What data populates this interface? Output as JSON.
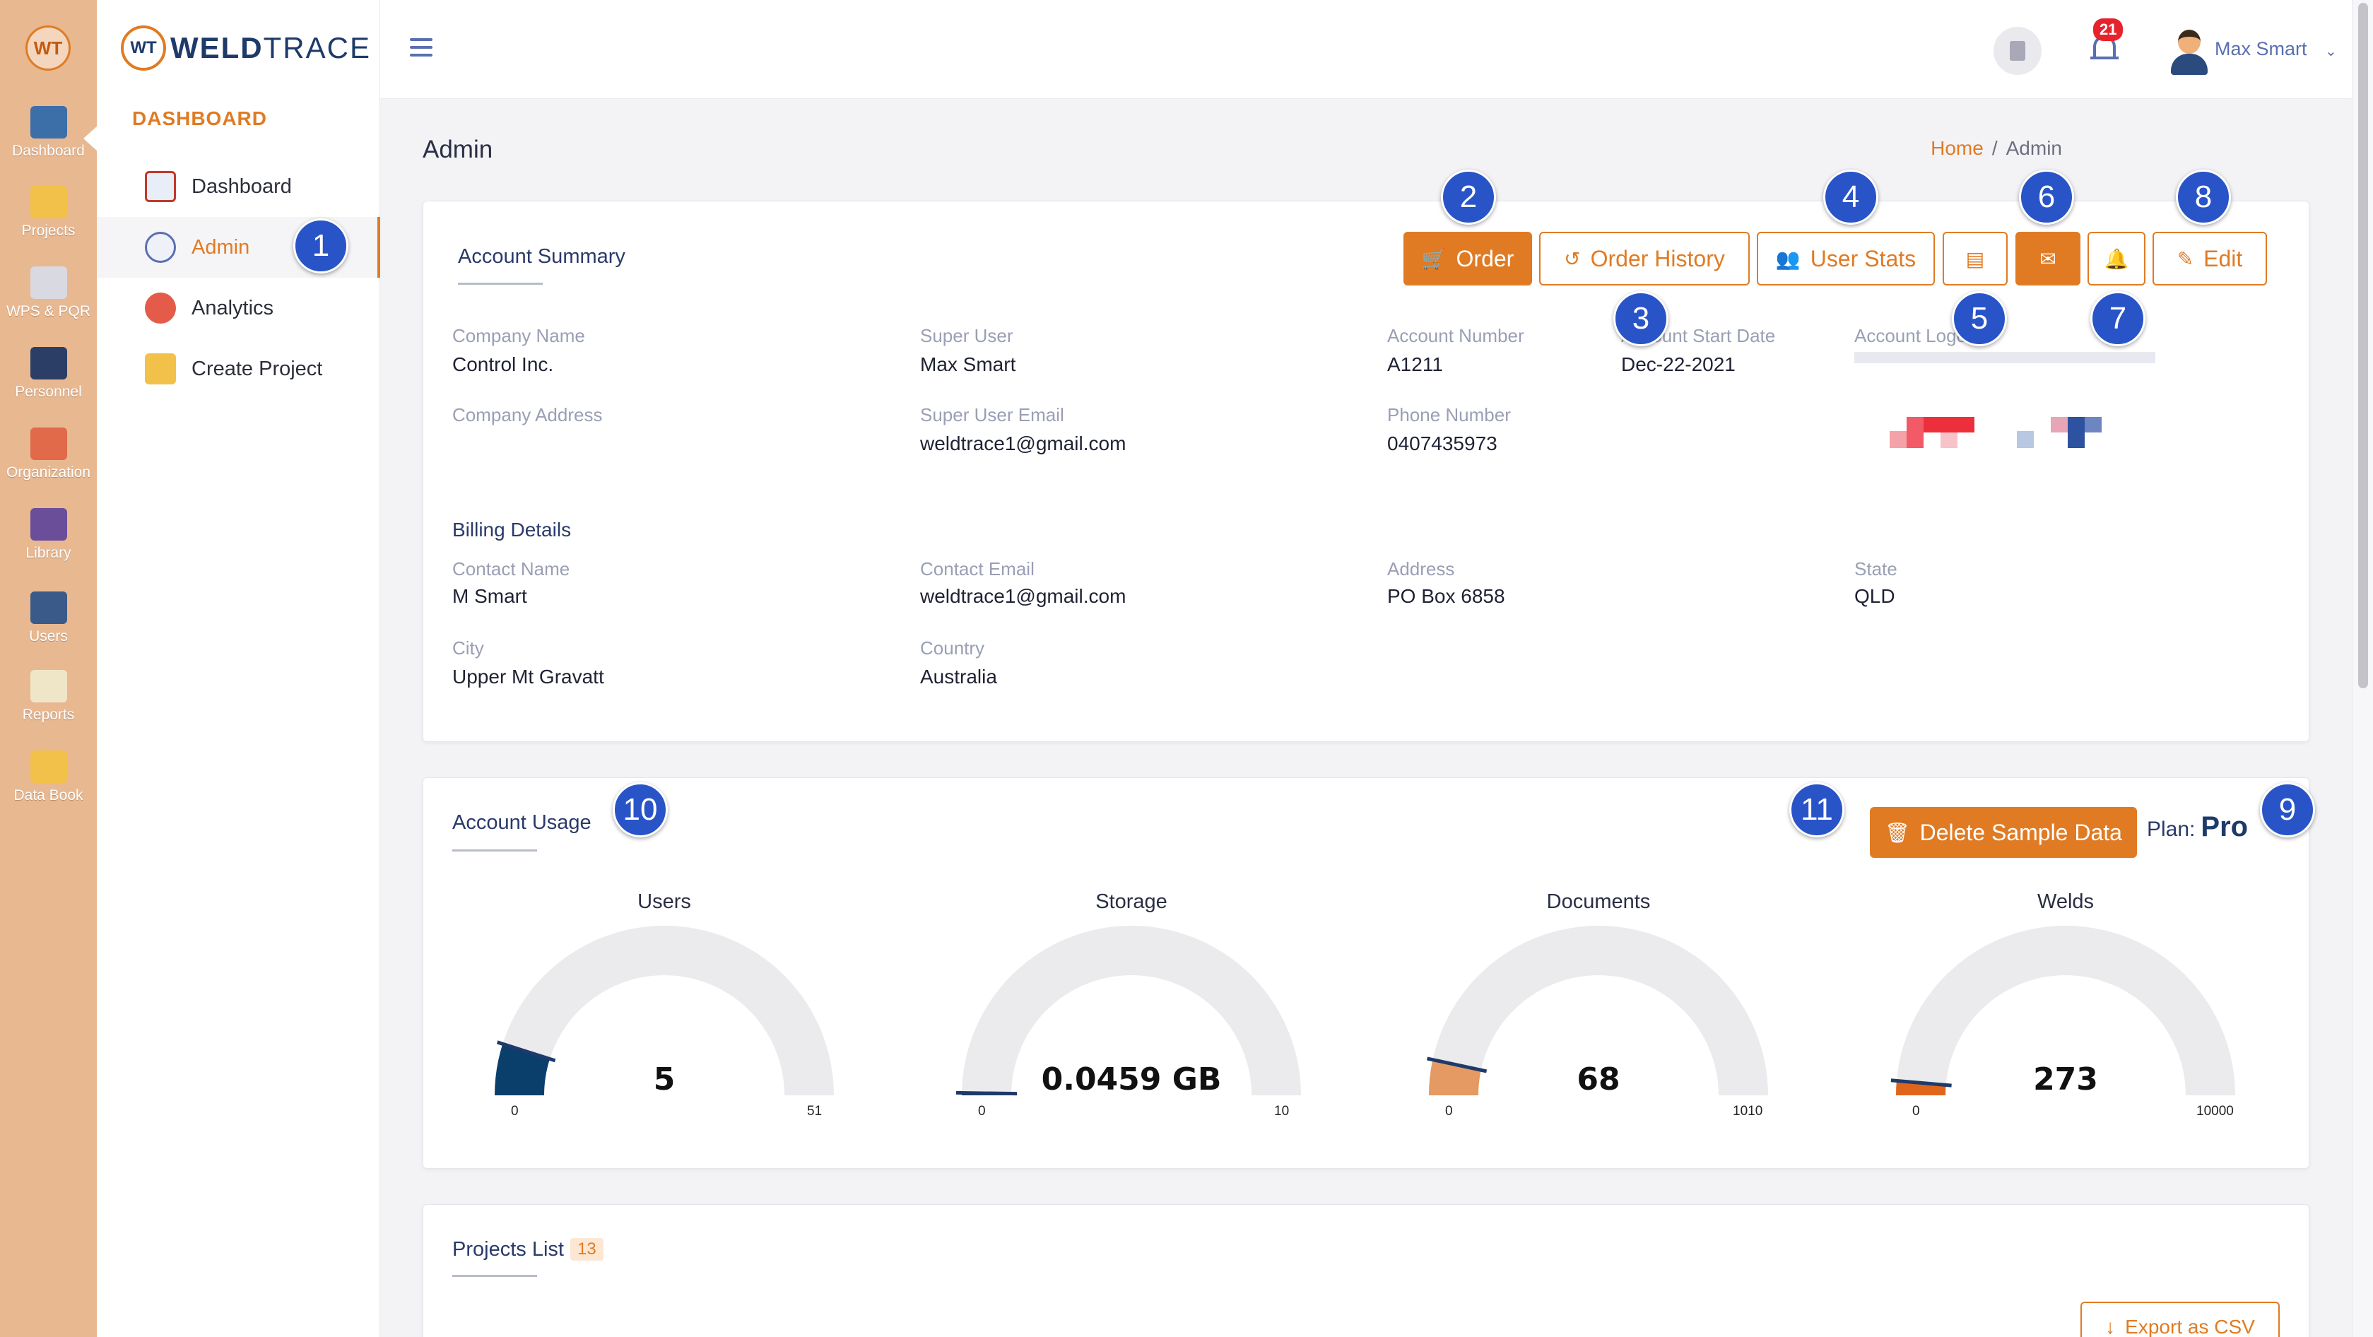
{
  "rail": {
    "logo": "WT",
    "items": [
      {
        "label": "Dashboard",
        "icon": "dashboard-monitor-icon"
      },
      {
        "label": "Projects",
        "icon": "projects-folder-icon"
      },
      {
        "label": "WPS & PQR",
        "icon": "wps-pqr-icon"
      },
      {
        "label": "Personnel",
        "icon": "personnel-welder-icon"
      },
      {
        "label": "Organization",
        "icon": "organization-icon"
      },
      {
        "label": "Library",
        "icon": "library-books-icon"
      },
      {
        "label": "Users",
        "icon": "users-group-icon"
      },
      {
        "label": "Reports",
        "icon": "reports-clipboard-icon"
      },
      {
        "label": "Data Book",
        "icon": "data-book-icon"
      }
    ]
  },
  "sidebar": {
    "brand_mark": "WT",
    "brand_weld": "WELD",
    "brand_trace": "TRACE",
    "section_title": "DASHBOARD",
    "items": [
      {
        "label": "Dashboard",
        "icon": "chart-icon"
      },
      {
        "label": "Admin",
        "icon": "gear-icon"
      },
      {
        "label": "Analytics",
        "icon": "analytics-icon"
      },
      {
        "label": "Create Project",
        "icon": "folder-plus-icon"
      }
    ]
  },
  "topbar": {
    "notification_count": "21",
    "user_name": "Max Smart",
    "caret": "⌄"
  },
  "page": {
    "title": "Admin",
    "breadcrumb_home": "Home",
    "breadcrumb_sep": "/",
    "breadcrumb_current": "Admin"
  },
  "account_summary": {
    "title": "Account Summary",
    "buttons": {
      "order": "Order",
      "order_history": "Order History",
      "user_stats": "User Stats",
      "edit": "Edit"
    },
    "fields": {
      "company_name_label": "Company Name",
      "company_name": "Control Inc.",
      "super_user_label": "Super User",
      "super_user": "Max Smart",
      "account_number_label": "Account Number",
      "account_number": "A1211",
      "account_start_date_label": "Account Start Date",
      "account_start_date": "Dec-22-2021",
      "account_logo_label": "Account Logo",
      "company_address_label": "Company Address",
      "super_user_email_label": "Super User Email",
      "super_user_email": "weldtrace1@gmail.com",
      "phone_number_label": "Phone Number",
      "phone_number": "0407435973"
    },
    "billing": {
      "title": "Billing Details",
      "contact_name_label": "Contact Name",
      "contact_name": "M Smart",
      "contact_email_label": "Contact Email",
      "contact_email": "weldtrace1@gmail.com",
      "address_label": "Address",
      "address": "PO Box 6858",
      "state_label": "State",
      "state": "QLD",
      "city_label": "City",
      "city": "Upper Mt Gravatt",
      "country_label": "Country",
      "country": "Australia"
    }
  },
  "account_usage": {
    "title": "Account Usage",
    "delete_button": "Delete Sample Data",
    "plan_label": "Plan:",
    "plan_value": "Pro",
    "gauges": [
      {
        "title": "Users",
        "value": 5,
        "display": "5",
        "min": "0",
        "max": "51",
        "max_num": 51,
        "color": "#0b3f6b"
      },
      {
        "title": "Storage",
        "value": 0.0459,
        "display": "0.0459 GB",
        "min": "0",
        "max": "10",
        "max_num": 10,
        "color": "#1e3a6b"
      },
      {
        "title": "Documents",
        "value": 68,
        "display": "68",
        "min": "0",
        "max": "1010",
        "max_num": 1010,
        "color": "#e49a62"
      },
      {
        "title": "Welds",
        "value": 273,
        "display": "273",
        "min": "0",
        "max": "10000",
        "max_num": 10000,
        "color": "#e0651c"
      }
    ]
  },
  "projects_list": {
    "title": "Projects List",
    "count": "13",
    "export_button": "Export as CSV"
  },
  "markers": [
    "1",
    "2",
    "3",
    "4",
    "5",
    "6",
    "7",
    "8",
    "9",
    "10",
    "11"
  ],
  "colors": {
    "accent": "#e07b24",
    "marker": "#2954c8",
    "rail": "#e8b891",
    "navy": "#1e3a6b"
  }
}
